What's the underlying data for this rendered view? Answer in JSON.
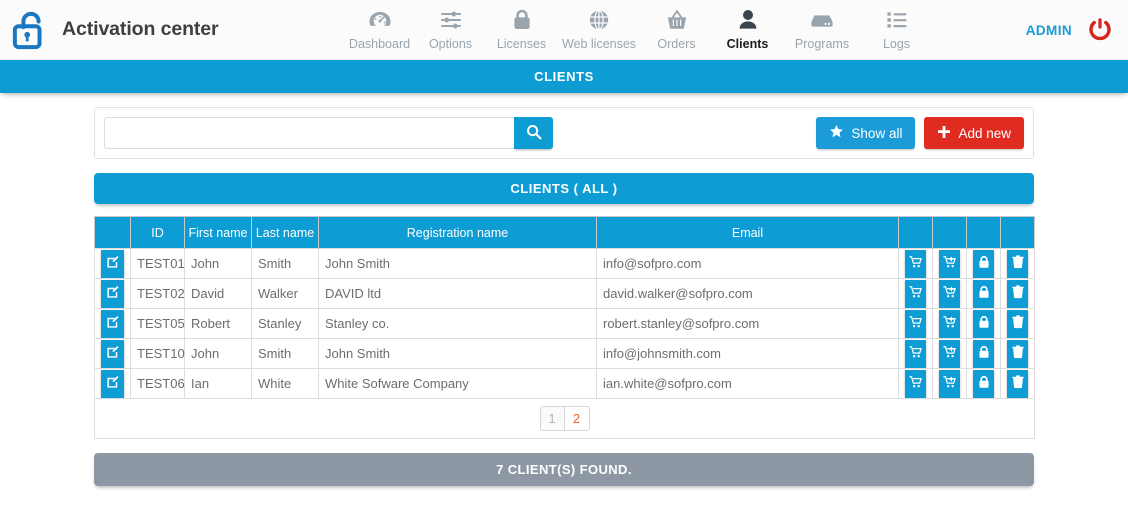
{
  "header": {
    "brand_title": "Activation center",
    "logo_icon": "open-padlock-icon",
    "admin_label": "ADMIN",
    "power_icon": "power-off-icon",
    "nav": [
      {
        "label": "Dashboard",
        "icon": "dashboard-gauge-icon",
        "active": false
      },
      {
        "label": "Options",
        "icon": "sliders-icon",
        "active": false
      },
      {
        "label": "Licenses",
        "icon": "padlock-icon",
        "active": false
      },
      {
        "label": "Web licenses",
        "icon": "globe-icon",
        "active": false
      },
      {
        "label": "Orders",
        "icon": "basket-icon",
        "active": false
      },
      {
        "label": "Clients",
        "icon": "user-icon",
        "active": true
      },
      {
        "label": "Programs",
        "icon": "server-icon",
        "active": false
      },
      {
        "label": "Logs",
        "icon": "list-icon",
        "active": false
      }
    ]
  },
  "page_banner": {
    "title": "CLIENTS"
  },
  "search": {
    "value": "",
    "placeholder": "",
    "search_icon": "magnifier-icon",
    "show_all_label": "Show all",
    "show_all_icon": "star-icon",
    "add_new_label": "Add new",
    "add_new_icon": "plus-icon"
  },
  "list_banner": {
    "title": "CLIENTS ( ALL )"
  },
  "table": {
    "columns": [
      "",
      "ID",
      "First name",
      "Last name",
      "Registration name",
      "Email",
      "",
      "",
      "",
      ""
    ],
    "row_icons": {
      "edit": "edit-square-icon",
      "cart": "shopping-cart-icon",
      "cart_plus": "cart-plus-icon",
      "lock": "padlock-icon",
      "delete": "trash-icon"
    },
    "rows": [
      {
        "id": "TEST01",
        "first_name": "John",
        "last_name": "Smith",
        "registration_name": "John Smith",
        "email": "info@sofpro.com"
      },
      {
        "id": "TEST02",
        "first_name": "David",
        "last_name": "Walker",
        "registration_name": "DAVID ltd",
        "email": "david.walker@sofpro.com"
      },
      {
        "id": "TEST05",
        "first_name": "Robert",
        "last_name": "Stanley",
        "registration_name": "Stanley co.",
        "email": "robert.stanley@sofpro.com"
      },
      {
        "id": "TEST10",
        "first_name": "John",
        "last_name": "Smith",
        "registration_name": "John Smith",
        "email": "info@johnsmith.com"
      },
      {
        "id": "TEST06",
        "first_name": "Ian",
        "last_name": "White",
        "registration_name": "White Sofware Company",
        "email": "ian.white@sofpro.com"
      }
    ]
  },
  "pagination": {
    "pages": [
      "1",
      "2"
    ],
    "current": "1"
  },
  "footer": {
    "found_text": "7 CLIENT(S) FOUND."
  },
  "colors": {
    "primary_blue": "#0d9cd4",
    "button_blue": "#1b9bd8",
    "danger_red": "#e02b20",
    "power_red": "#d8231b",
    "gray_bar": "#8d98a4",
    "page_link_orange": "#e8672a",
    "nav_inactive": "#9aa4ad"
  }
}
